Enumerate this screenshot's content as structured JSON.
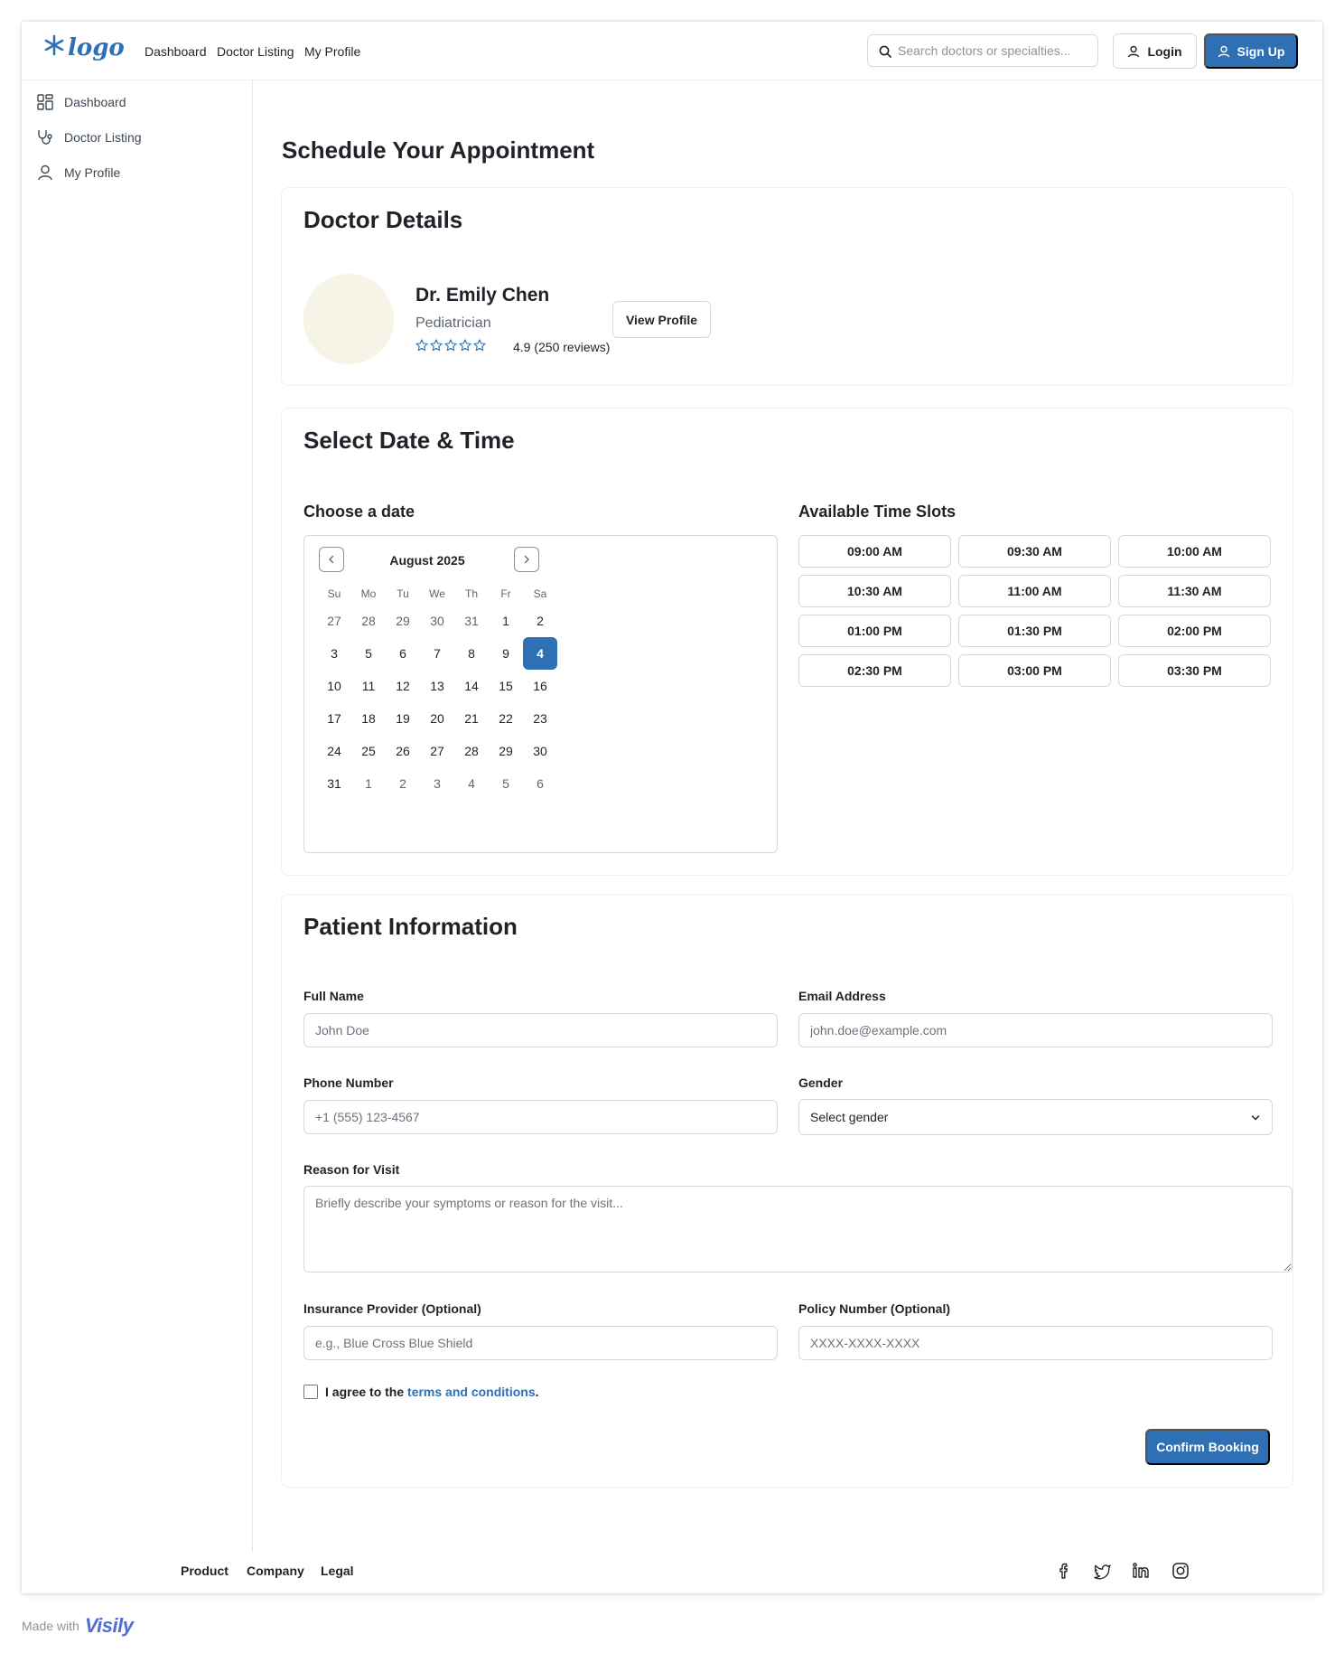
{
  "header": {
    "nav": [
      "Dashboard",
      "Doctor Listing",
      "My Profile"
    ],
    "search_placeholder": "Search doctors or specialties...",
    "login_label": "Login",
    "signup_label": "Sign Up"
  },
  "sidebar": {
    "items": [
      {
        "label": "Dashboard",
        "icon": "dashboard-icon"
      },
      {
        "label": "Doctor Listing",
        "icon": "stethoscope-icon"
      },
      {
        "label": "My Profile",
        "icon": "user-icon"
      }
    ]
  },
  "page": {
    "title": "Schedule Your Appointment"
  },
  "doctor": {
    "section_title": "Doctor Details",
    "name": "Dr. Emily Chen",
    "specialty": "Pediatrician",
    "rating_text": "4.9 (250 reviews)",
    "view_profile_label": "View Profile"
  },
  "datetime": {
    "section_title": "Select Date & Time",
    "choose_date_label": "Choose a date",
    "month": "August 2025",
    "weekdays": [
      "Su",
      "Mo",
      "Tu",
      "We",
      "Th",
      "Fr",
      "Sa"
    ],
    "weeks": [
      [
        "27",
        "28",
        "29",
        "30",
        "31",
        "1",
        "2"
      ],
      [
        "3",
        "5",
        "6",
        "7",
        "8",
        "9",
        "4"
      ],
      [
        "10",
        "11",
        "12",
        "13",
        "14",
        "15",
        "16"
      ],
      [
        "17",
        "18",
        "19",
        "20",
        "21",
        "22",
        "23"
      ],
      [
        "24",
        "25",
        "26",
        "27",
        "28",
        "29",
        "30"
      ],
      [
        "31",
        "1",
        "2",
        "3",
        "4",
        "5",
        "6"
      ]
    ],
    "selected_day": "4",
    "slots_label": "Available Time Slots",
    "slots": [
      "09:00 AM",
      "09:30 AM",
      "10:00 AM",
      "10:30 AM",
      "11:00 AM",
      "11:30 AM",
      "01:00 PM",
      "01:30 PM",
      "02:00 PM",
      "02:30 PM",
      "03:00 PM",
      "03:30 PM"
    ]
  },
  "patient": {
    "section_title": "Patient Information",
    "full_name_label": "Full Name",
    "full_name_placeholder": "John Doe",
    "email_label": "Email Address",
    "email_placeholder": "john.doe@example.com",
    "phone_label": "Phone Number",
    "phone_placeholder": "+1 (555) 123-4567",
    "gender_label": "Gender",
    "gender_value": "Select gender",
    "reason_label": "Reason for Visit",
    "reason_placeholder": "Briefly describe your symptoms or reason for the visit...",
    "insurance_label": "Insurance Provider (Optional)",
    "insurance_placeholder": "e.g., Blue Cross Blue Shield",
    "policy_label": "Policy Number (Optional)",
    "policy_placeholder": "XXXX-XXXX-XXXX",
    "agree_prefix": "I agree to the ",
    "agree_link": "terms and conditions",
    "agree_suffix": ".",
    "confirm_label": "Confirm Booking"
  },
  "footer": {
    "links": [
      "Product",
      "Company",
      "Legal"
    ],
    "social": [
      "facebook-icon",
      "twitter-icon",
      "linkedin-icon",
      "instagram-icon"
    ]
  },
  "watermark": {
    "prefix": "Made with",
    "brand": "Visily"
  },
  "colors": {
    "primary": "#2f6fb3",
    "avatar_bg": "#f6f4e6",
    "border": "#d5d9de"
  }
}
